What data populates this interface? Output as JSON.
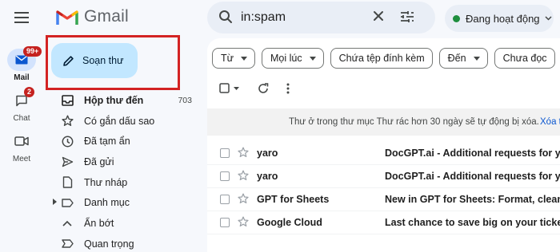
{
  "app": {
    "name": "Gmail"
  },
  "rail": {
    "items": [
      {
        "label": "Mail",
        "badge": "99+"
      },
      {
        "label": "Chat",
        "badge": "2"
      },
      {
        "label": "Meet",
        "badge": ""
      }
    ]
  },
  "search": {
    "value": "in:spam"
  },
  "status": {
    "label": "Đang hoạt động",
    "color": "#1e8e3e"
  },
  "compose": {
    "label": "Soạn thư"
  },
  "nav": {
    "items": [
      {
        "label": "Hộp thư đến",
        "count": "703",
        "icon": "inbox-icon"
      },
      {
        "label": "Có gắn dấu sao",
        "count": "",
        "icon": "star-icon"
      },
      {
        "label": "Đã tạm ẩn",
        "count": "",
        "icon": "clock-icon"
      },
      {
        "label": "Đã gửi",
        "count": "",
        "icon": "send-icon"
      },
      {
        "label": "Thư nháp",
        "count": "",
        "icon": "draft-icon"
      },
      {
        "label": "Danh mục",
        "count": "",
        "icon": "label-icon"
      },
      {
        "label": "Ẩn bớt",
        "count": "",
        "icon": "chevron-up-icon"
      },
      {
        "label": "Quan trọng",
        "count": "",
        "icon": "important-icon"
      }
    ]
  },
  "filters": [
    "Từ",
    "Mọi lúc",
    "Chứa tệp đính kèm",
    "Đến",
    "Chưa đọc"
  ],
  "notice": {
    "text": "Thư ở trong thư mục Thư rác hơn 30 ngày sẽ tự động bị xóa.",
    "link": "Xóa t"
  },
  "emails": [
    {
      "sender": "yaro",
      "subject": "DocGPT.ai - Additional requests for you"
    },
    {
      "sender": "yaro",
      "subject": "DocGPT.ai - Additional requests for you"
    },
    {
      "sender": "GPT for Sheets",
      "subject": "New in GPT for Sheets: Format, clean, pi"
    },
    {
      "sender": "Google Cloud",
      "subject": "Last chance to save big on your ticket to"
    }
  ],
  "colors": {
    "accent": "#c2e7ff",
    "highlight": "#d32323",
    "unread_badge": "#c5221f"
  }
}
